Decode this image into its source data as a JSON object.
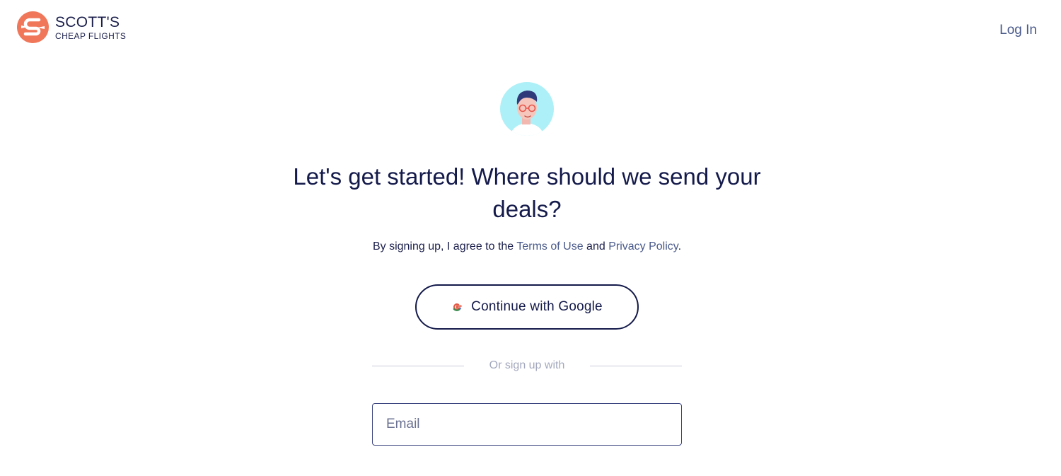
{
  "brand": {
    "title": "SCOTT'S",
    "subtitle": "CHEAP FLIGHTS",
    "accent_color": "#f0775a",
    "navy_color": "#141a4a"
  },
  "header": {
    "login_label": "Log In"
  },
  "main": {
    "headline_line1": "Let's get started! Where should we send your",
    "headline_line2": "deals?",
    "terms_prefix": "By signing up, I agree to the ",
    "terms_link": "Terms of Use",
    "terms_and": " and ",
    "privacy_link": "Privacy Policy",
    "terms_suffix": ".",
    "google_button_label": "Continue with Google",
    "divider_text": "Or sign up with",
    "email": {
      "value": "",
      "placeholder": "Email"
    }
  },
  "icons": {
    "logo": "plane-s-logo-icon",
    "avatar": "scott-avatar-illustration",
    "google": "google-g-icon"
  }
}
